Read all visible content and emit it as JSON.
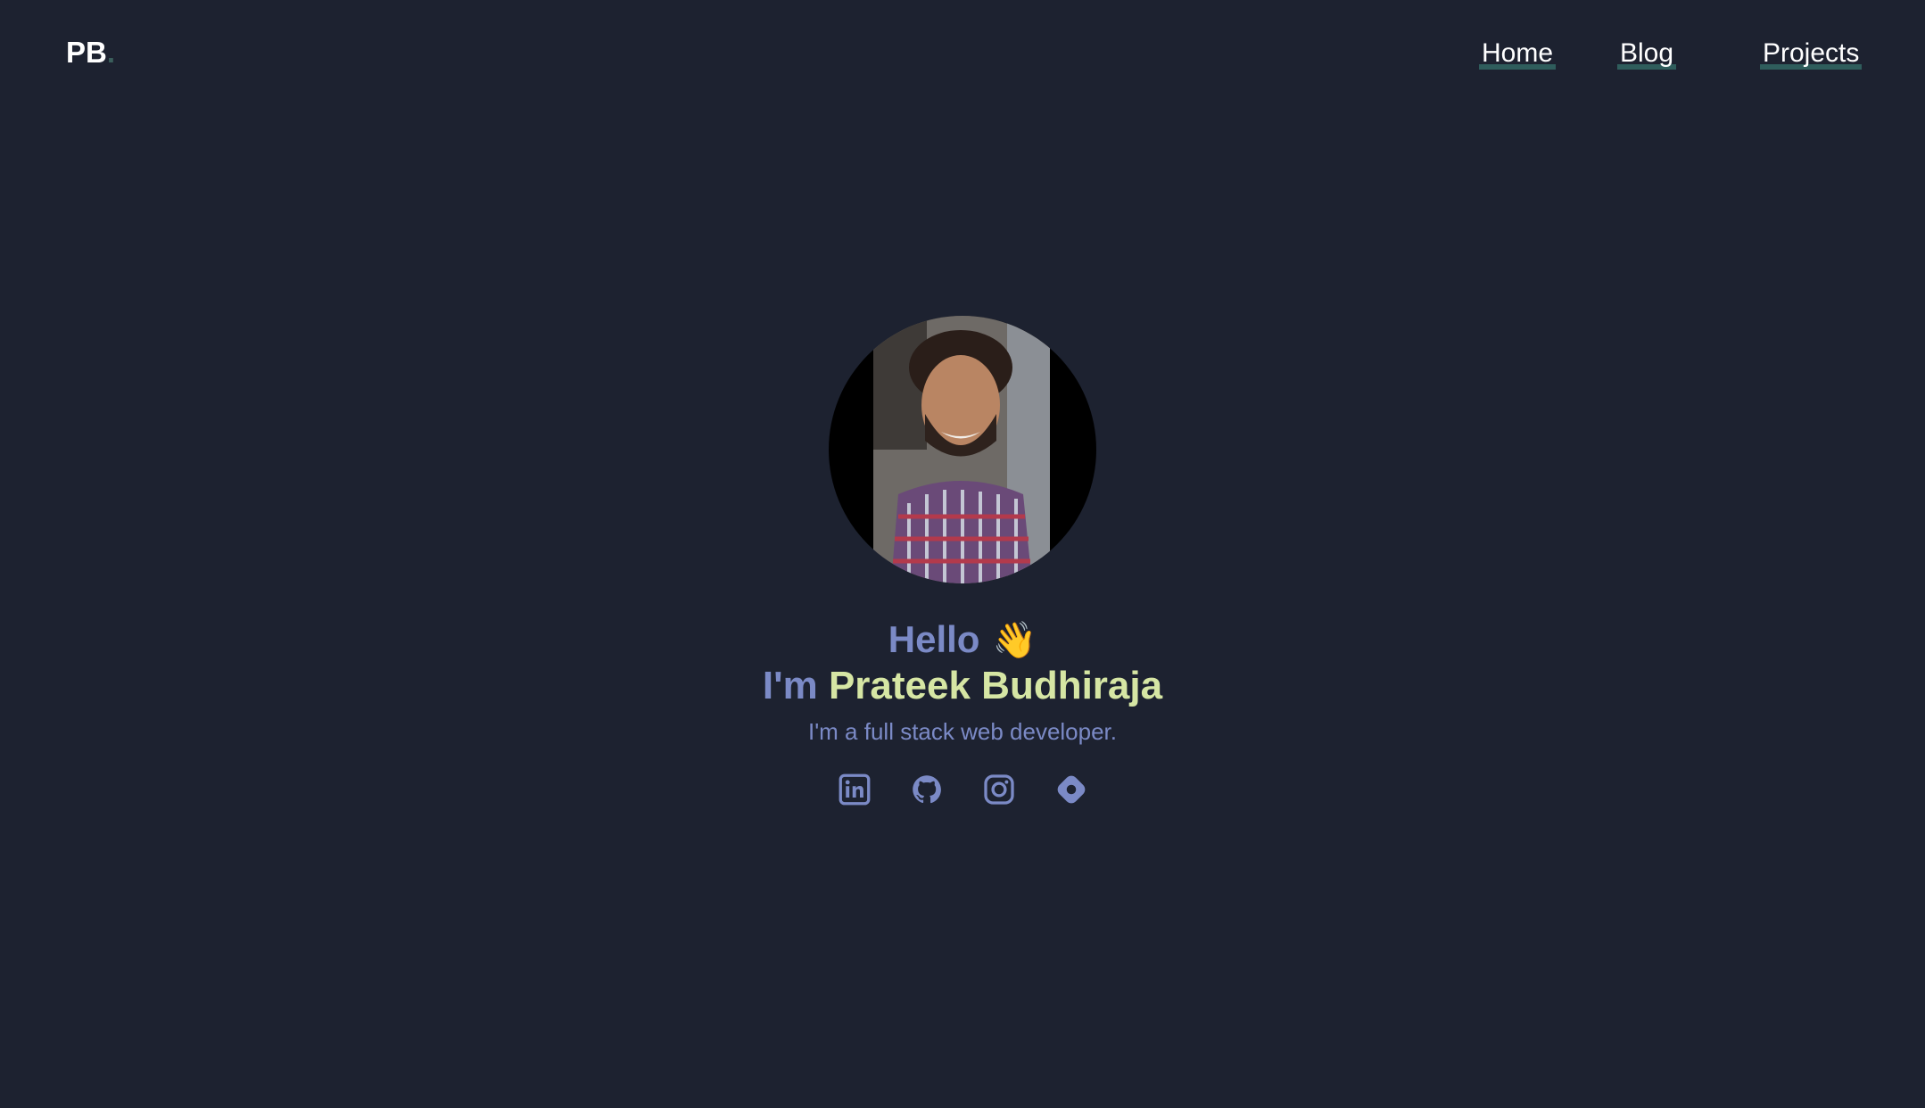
{
  "header": {
    "logo_text": "PB",
    "logo_dot": "."
  },
  "nav": {
    "items": [
      {
        "label": "Home"
      },
      {
        "label": "Blog"
      },
      {
        "label": "Projects"
      }
    ]
  },
  "hero": {
    "hello": "Hello",
    "wave_emoji": "👋",
    "intro_prefix": "I'm",
    "name": "Prateek Budhiraja",
    "tagline": "I'm a full stack web developer."
  },
  "socials": [
    {
      "icon": "linkedin-icon"
    },
    {
      "icon": "github-icon"
    },
    {
      "icon": "instagram-icon"
    },
    {
      "icon": "hashnode-icon"
    }
  ],
  "colors": {
    "background": "#1d2230",
    "accent": "#7b8ac6",
    "name": "#d6e6a4",
    "nav_underline": "#2f5d5c"
  }
}
